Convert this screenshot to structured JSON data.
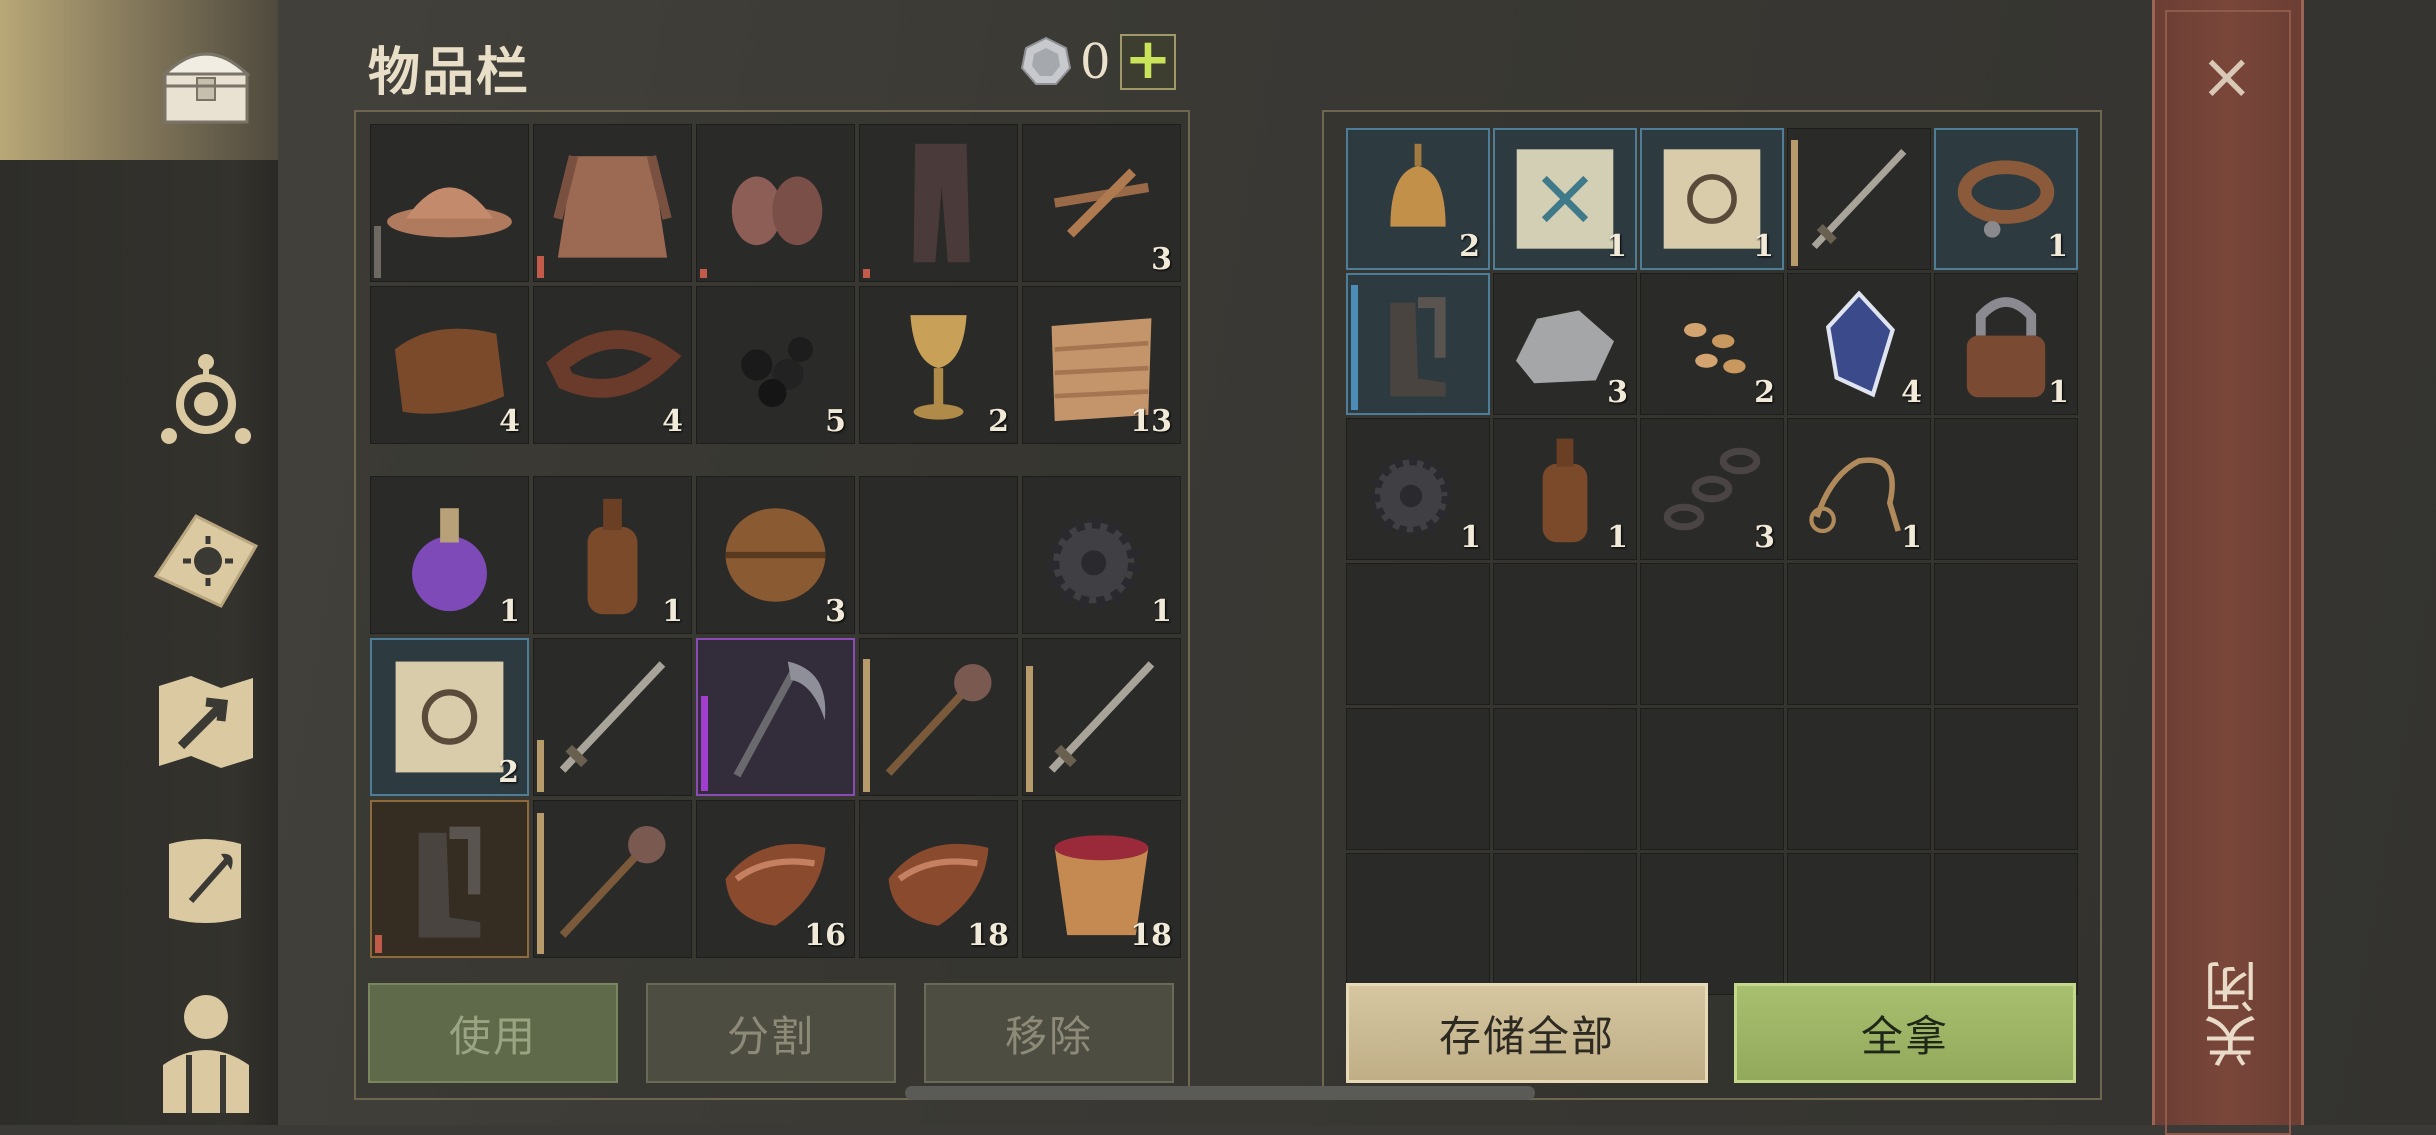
{
  "title": "物品栏",
  "currency": {
    "count": "0",
    "plus": "+"
  },
  "sidebar": {
    "items": [
      {
        "name": "chest-icon",
        "active": true
      },
      {
        "name": "skills-icon"
      },
      {
        "name": "sun-book-icon"
      },
      {
        "name": "map-icon"
      },
      {
        "name": "quest-scroll-icon"
      },
      {
        "name": "character-icon"
      }
    ]
  },
  "inventory": {
    "equipment": [
      {
        "item": "helmet",
        "qty": "",
        "bar": 0.35,
        "bar_color": "#6e6a62"
      },
      {
        "item": "chainmail",
        "qty": "",
        "bar": 0.15,
        "bar_color": "#c25b4a"
      },
      {
        "item": "gloves",
        "qty": "",
        "bar": 0.06,
        "bar_color": "#c25b4a"
      },
      {
        "item": "leggings",
        "qty": "",
        "bar": 0.06,
        "bar_color": "#c25b4a"
      },
      {
        "item": "nails",
        "qty": "3"
      },
      {
        "item": "leather",
        "qty": "4"
      },
      {
        "item": "leather-strap",
        "qty": "4"
      },
      {
        "item": "coal",
        "qty": "5"
      },
      {
        "item": "goblet",
        "qty": "2"
      },
      {
        "item": "fabric",
        "qty": "13"
      }
    ],
    "bag": [
      {
        "item": "potion",
        "qty": "1"
      },
      {
        "item": "bottle",
        "qty": "1"
      },
      {
        "item": "barrel",
        "qty": "3"
      },
      {
        "item": "empty",
        "qty": ""
      },
      {
        "item": "gears",
        "qty": "1"
      },
      {
        "item": "recipe-scroll",
        "qty": "2",
        "frame": "blue"
      },
      {
        "item": "sword",
        "qty": "",
        "bar": 0.35,
        "bar_color": "#b89b6a"
      },
      {
        "item": "scythe",
        "qty": "",
        "frame": "purple",
        "bar": 0.65,
        "bar_color": "#a13ed0"
      },
      {
        "item": "mace",
        "qty": "",
        "bar": 0.9,
        "bar_color": "#b89b6a"
      },
      {
        "item": "sword",
        "qty": "",
        "bar": 0.85,
        "bar_color": "#b89b6a"
      },
      {
        "item": "boots",
        "qty": "",
        "frame": "orange",
        "bar": 0.12,
        "bar_color": "#c25b4a"
      },
      {
        "item": "mace",
        "qty": "",
        "bar": 0.95,
        "bar_color": "#b89b6a"
      },
      {
        "item": "meat",
        "qty": "16"
      },
      {
        "item": "meat",
        "qty": "18"
      },
      {
        "item": "berry-bucket",
        "qty": "18"
      }
    ]
  },
  "storage": {
    "slots": [
      {
        "item": "bell",
        "qty": "2",
        "frame": "blue"
      },
      {
        "item": "rune-scroll",
        "qty": "1",
        "frame": "blue"
      },
      {
        "item": "recipe-scroll",
        "qty": "1",
        "frame": "blue"
      },
      {
        "item": "sword",
        "qty": "",
        "bar": 0.95,
        "bar_color": "#b89b6a"
      },
      {
        "item": "collar",
        "qty": "1",
        "frame": "blue"
      },
      {
        "item": "boots",
        "qty": "",
        "frame": "blue",
        "bar": 0.95,
        "bar_color": "#4e8cb8"
      },
      {
        "item": "stone",
        "qty": "3"
      },
      {
        "item": "seeds",
        "qty": "2"
      },
      {
        "item": "crystal",
        "qty": "4"
      },
      {
        "item": "padlock",
        "qty": "1"
      },
      {
        "item": "gears",
        "qty": "1"
      },
      {
        "item": "bottle",
        "qty": "1"
      },
      {
        "item": "chain",
        "qty": "3"
      },
      {
        "item": "rope",
        "qty": "1"
      },
      {
        "item": "empty",
        "qty": ""
      },
      {
        "item": "empty"
      },
      {
        "item": "empty"
      },
      {
        "item": "empty"
      },
      {
        "item": "empty"
      },
      {
        "item": "empty"
      },
      {
        "item": "empty"
      },
      {
        "item": "empty"
      },
      {
        "item": "empty"
      },
      {
        "item": "empty"
      },
      {
        "item": "empty"
      },
      {
        "item": "empty"
      },
      {
        "item": "empty"
      },
      {
        "item": "empty"
      },
      {
        "item": "empty"
      },
      {
        "item": "empty"
      }
    ]
  },
  "buttons": {
    "use": "使用",
    "split": "分割",
    "remove": "移除",
    "store_all": "存储全部",
    "take_all": "全拿"
  },
  "close": {
    "x": "×",
    "label": "关闭"
  },
  "colors": {
    "accent_green": "#a9bf70",
    "accent_tan": "#d6c7a1",
    "close_red": "#7a463a"
  }
}
